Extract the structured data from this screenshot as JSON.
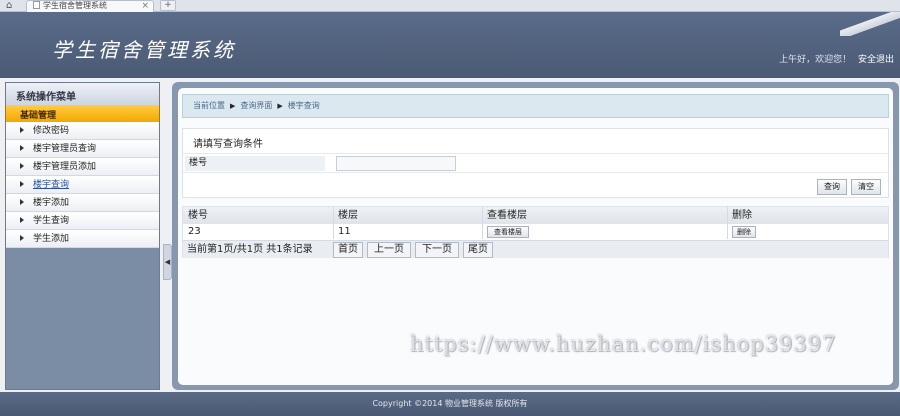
{
  "browser": {
    "tab_title": "学生宿舍管理系统",
    "tab_close": "×",
    "new_tab": "+"
  },
  "header": {
    "title": "学生宿舍管理系统",
    "greeting": "上午好，欢迎您！",
    "logout": "安全退出"
  },
  "sidebar": {
    "heading": "系统操作菜单",
    "group": "基础管理",
    "items": [
      {
        "label": "修改密码"
      },
      {
        "label": "楼宇管理员查询"
      },
      {
        "label": "楼宇管理员添加"
      },
      {
        "label": "楼宇查询",
        "active": true
      },
      {
        "label": "楼宇添加"
      },
      {
        "label": "学生查询"
      },
      {
        "label": "学生添加"
      }
    ],
    "collapse_glyph": "◀"
  },
  "breadcrumb": [
    "当前位置",
    "查询界面",
    "楼宇查询"
  ],
  "search": {
    "title": "请填写查询条件",
    "field_label": "楼号",
    "field_value": "",
    "query_button": "查询",
    "clear_button": "清空"
  },
  "table": {
    "columns": [
      "楼号",
      "楼层",
      "查看楼层",
      "删除"
    ],
    "rows": [
      {
        "building": "23",
        "floor": "11",
        "view": "查看楼层",
        "delete": "删除"
      }
    ]
  },
  "pager": {
    "status": "当前第1页/共1页  共1条记录",
    "first": "首页",
    "prev": "上一页",
    "next": "下一页",
    "last": "尾页"
  },
  "watermark": "https://www.huzhan.com/ishop39397",
  "footer": "Copyright ©2014 物业管理系统 版权所有",
  "colors": {
    "header": "#5a6c8a",
    "menu_group": "#f2a900",
    "sidebar": "#7b8ca5",
    "breadcrumb_bg": "#dce8f0"
  }
}
